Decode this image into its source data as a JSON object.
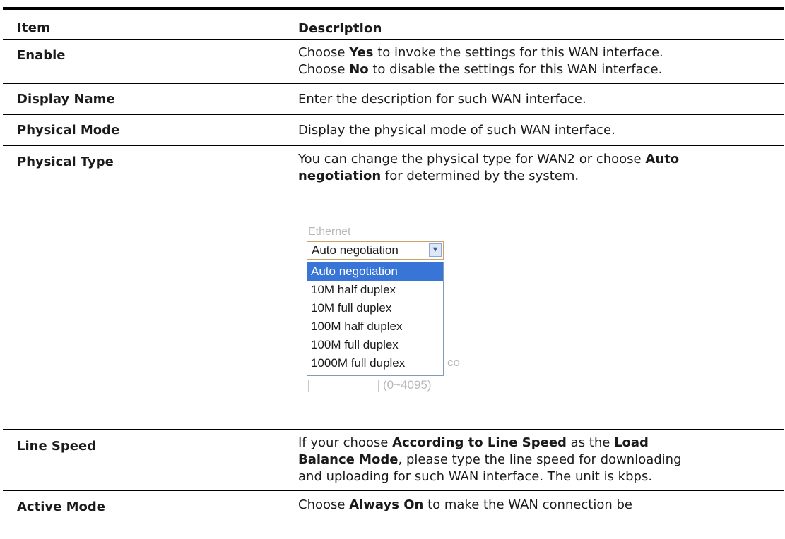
{
  "header": {
    "item": "Item",
    "description": "Description"
  },
  "rows": [
    {
      "item": "Enable",
      "lines": [
        [
          "Choose ",
          "Yes",
          " to invoke the settings for this WAN interface."
        ],
        [
          "Choose ",
          "No",
          " to disable the settings for this WAN interface."
        ]
      ]
    },
    {
      "item": "Display Name",
      "text": "Enter the description for such WAN interface."
    },
    {
      "item": "Physical Mode",
      "text": "Display the physical mode of such WAN interface."
    },
    {
      "item": "Physical Type",
      "t1": "You can change the physical type for WAN2 or choose ",
      "b1": "Auto",
      "b2": "negotiation",
      "t2": " for determined by the system."
    },
    {
      "item": "Line Speed",
      "p1": "If your choose ",
      "b1": "According to Line Speed",
      "p2": " as the ",
      "b2": "Load",
      "b3": "Balance Mode",
      "p3": ", please type the line speed for downloading",
      "p4": "and uploading for such WAN interface. The unit is kbps."
    },
    {
      "item": "Active Mode",
      "p1": "Choose ",
      "b1": "Always On",
      "p2": " to make the WAN connection be"
    }
  ],
  "dropdown": {
    "ghost_top": "Ethernet",
    "selected": "Auto negotiation",
    "options": [
      "Auto negotiation",
      "10M half duplex",
      "10M full duplex",
      "100M half duplex",
      "100M full duplex",
      "1000M full duplex"
    ],
    "ghost_right": "co",
    "ghost_bottom": "(0~4095)"
  }
}
